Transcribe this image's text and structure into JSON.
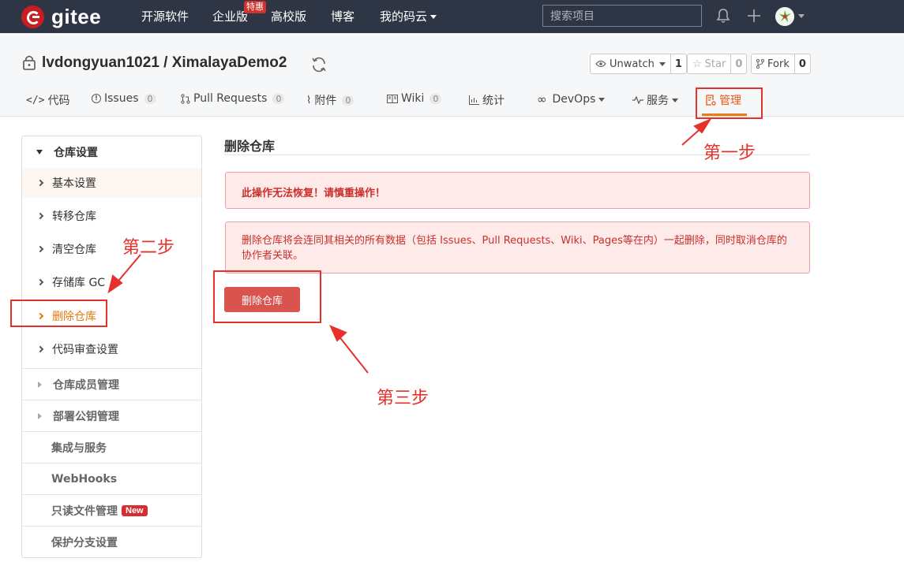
{
  "header": {
    "logo_text": "gitee",
    "nav": [
      "开源软件",
      "企业版",
      "高校版",
      "博客",
      "我的码云"
    ],
    "promo_badge": "特惠",
    "search_placeholder": "搜索项目"
  },
  "repo": {
    "title": "lvdongyuan1021 / XimalayaDemo2",
    "watch": {
      "label": "Unwatch",
      "count": "1"
    },
    "star": {
      "label": "Star",
      "count": "0"
    },
    "fork": {
      "label": "Fork",
      "count": "0"
    }
  },
  "tabs": [
    {
      "label": "代码"
    },
    {
      "label": "Issues",
      "count": "0"
    },
    {
      "label": "Pull Requests",
      "count": "0"
    },
    {
      "label": "附件",
      "count": "0"
    },
    {
      "label": "Wiki",
      "count": "0"
    },
    {
      "label": "统计"
    },
    {
      "label": "DevOps"
    },
    {
      "label": "服务"
    },
    {
      "label": "管理"
    }
  ],
  "sidebar": {
    "section_title": "仓库设置",
    "items": [
      "基本设置",
      "转移仓库",
      "清空仓库",
      "存储库 GC",
      "删除仓库",
      "代码审查设置"
    ],
    "groups": [
      "仓库成员管理",
      "部署公钥管理",
      "集成与服务",
      "WebHooks",
      "只读文件管理",
      "保护分支设置"
    ],
    "new_badge": "New"
  },
  "main": {
    "title": "删除仓库",
    "warning": "此操作无法恢复！请慎重操作！",
    "description": "删除仓库将会连同其相关的所有数据（包括 Issues、Pull Requests、Wiki、Pages等在内）一起删除，同时取消仓库的协作者关联。",
    "delete_button": "删除仓库"
  },
  "annotations": {
    "step1": "第一步",
    "step2": "第二步",
    "step3": "第三步",
    "color": "#e8302a"
  }
}
